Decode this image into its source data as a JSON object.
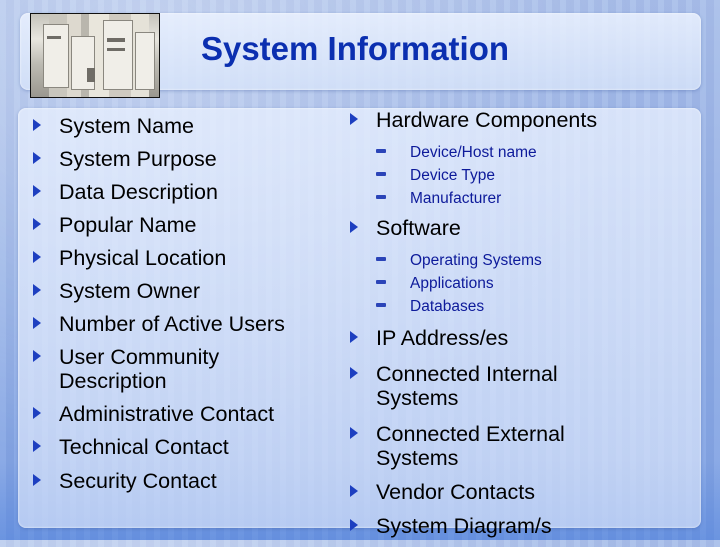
{
  "slide": {
    "title": "System Information",
    "image": {
      "icon": "server-racks-photo"
    },
    "left_column": {
      "items": [
        {
          "label": "System Name"
        },
        {
          "label": "System Purpose"
        },
        {
          "label": "Data Description"
        },
        {
          "label": "Popular Name"
        },
        {
          "label": "Physical Location"
        },
        {
          "label": "System Owner"
        },
        {
          "label": "Number of Active Users"
        },
        {
          "label": "User Community Description"
        },
        {
          "label": "Administrative Contact"
        },
        {
          "label": "Technical Contact"
        },
        {
          "label": "Security Contact"
        }
      ]
    },
    "right_column": {
      "items": [
        {
          "label": "Hardware Components",
          "subitems": [
            "Device/Host name",
            "Device Type",
            "Manufacturer"
          ]
        },
        {
          "label": "Software",
          "subitems": [
            "Operating Systems",
            "Applications",
            "Databases"
          ]
        },
        {
          "label": "IP Address/es"
        },
        {
          "label": "Connected Internal Systems"
        },
        {
          "label": "Connected External Systems"
        },
        {
          "label": "Vendor Contacts"
        },
        {
          "label": "System Diagram/s"
        }
      ]
    },
    "colors": {
      "title": "#0b2fb0",
      "bullet_arrow": "#1d3fc0",
      "subitem_text": "#0d1a9a",
      "body_text": "#000000"
    }
  }
}
